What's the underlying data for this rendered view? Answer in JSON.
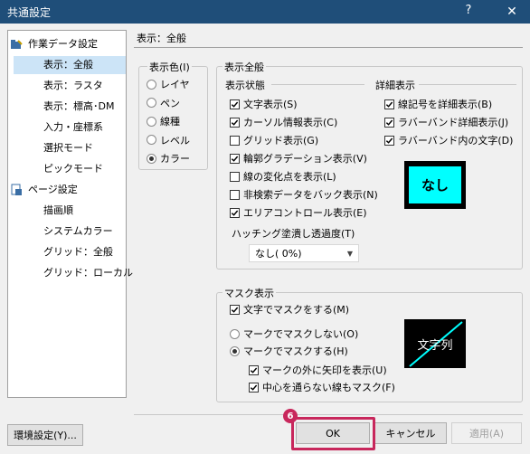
{
  "window": {
    "title": "共通設定",
    "help": "?",
    "close": "✕"
  },
  "tree": [
    {
      "label": "作業データ設定",
      "level": 0,
      "icon": "folder-tools-icon"
    },
    {
      "label": "表示：全般",
      "level": 1,
      "selected": true
    },
    {
      "label": "表示：ラスタ",
      "level": 1
    },
    {
      "label": "表示：標高･DM",
      "level": 1
    },
    {
      "label": "入力・座標系",
      "level": 1
    },
    {
      "label": "選択モード",
      "level": 1
    },
    {
      "label": "ピックモード",
      "level": 1
    },
    {
      "label": "ページ設定",
      "level": 0,
      "icon": "page-settings-icon"
    },
    {
      "label": "描画順",
      "level": 1
    },
    {
      "label": "システムカラー",
      "level": 1
    },
    {
      "label": "グリッド：全般",
      "level": 1
    },
    {
      "label": "グリッド：ローカル",
      "level": 1
    }
  ],
  "section_title": "表示：全般",
  "display_color": {
    "label": "表示色(I)",
    "options": [
      {
        "label": "レイヤ",
        "checked": false
      },
      {
        "label": "ペン",
        "checked": false
      },
      {
        "label": "線種",
        "checked": false
      },
      {
        "label": "レベル",
        "checked": false
      },
      {
        "label": "カラー",
        "checked": true
      }
    ]
  },
  "display_general": {
    "label": "表示全般",
    "state_label": "表示状態",
    "detail_label": "詳細表示",
    "state_items": [
      {
        "label": "文字表示(S)",
        "checked": true
      },
      {
        "label": "カーソル情報表示(C)",
        "checked": true
      },
      {
        "label": "グリッド表示(G)",
        "checked": false
      },
      {
        "label": "輪郭グラデーション表示(V)",
        "checked": true
      },
      {
        "label": "線の変化点を表示(L)",
        "checked": false
      },
      {
        "label": "非検索データをバック表示(N)",
        "checked": false
      },
      {
        "label": "エリアコントロール表示(E)",
        "checked": true
      }
    ],
    "detail_items": [
      {
        "label": "線記号を詳細表示(B)",
        "checked": true
      },
      {
        "label": "ラバーバンド詳細表示(J)",
        "checked": true
      },
      {
        "label": "ラバーバンド内の文字(D)",
        "checked": true
      }
    ],
    "hatch_label": "ハッチング塗潰し透過度(T)",
    "hatch_value": "なし( 0%)",
    "preview_text": "なし",
    "preview_fill": "#00ffff"
  },
  "mask": {
    "label": "マスク表示",
    "text_mask": {
      "label": "文字でマスクをする(M)",
      "checked": true
    },
    "radios": [
      {
        "label": "マークでマスクしない(O)",
        "checked": false
      },
      {
        "label": "マークでマスクする(H)",
        "checked": true
      }
    ],
    "sub_items": [
      {
        "label": "マークの外に矢印を表示(U)",
        "checked": true
      },
      {
        "label": "中心を通らない線もマスク(F)",
        "checked": true
      }
    ],
    "preview_text": "文字列",
    "preview_line": "#00ffff"
  },
  "buttons": {
    "env": "環境設定(Y)...",
    "ok": "OK",
    "cancel": "キャンセル",
    "apply": "適用(A)"
  },
  "step_badge": "6",
  "highlight_color": "#c8275c"
}
